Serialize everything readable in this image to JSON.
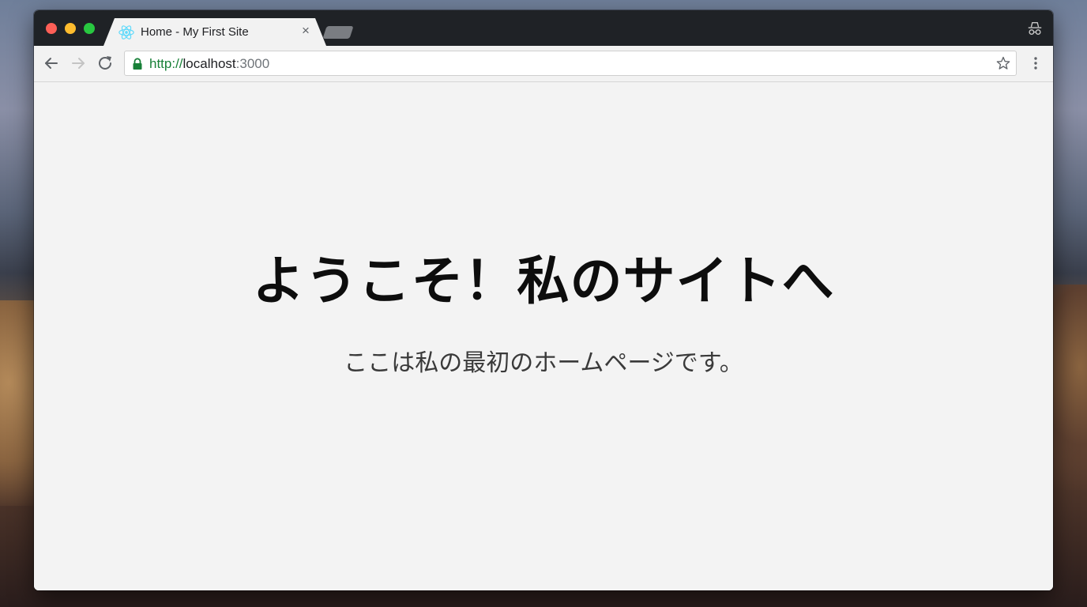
{
  "browser": {
    "tab": {
      "title": "Home - My First Site",
      "close_glyph": "×",
      "favicon": "react-atom-icon"
    },
    "address": {
      "scheme": "http://",
      "host": "localhost",
      "port": ":3000"
    },
    "icons": {
      "back": "arrow-left-icon",
      "forward": "arrow-right-icon",
      "reload": "reload-icon",
      "lock": "lock-icon",
      "bookmark": "star-icon",
      "menu": "kebab-menu-icon",
      "profile": "incognito-icon"
    },
    "colors": {
      "secure_green": "#188038",
      "traffic_close": "#fe5f57",
      "traffic_minimize": "#febc2e",
      "traffic_maximize": "#28c840",
      "react_blue": "#61dafb"
    }
  },
  "page": {
    "headline": "ようこそ！私のサイトへ",
    "subtitle": "ここは私の最初のホームページです。"
  }
}
